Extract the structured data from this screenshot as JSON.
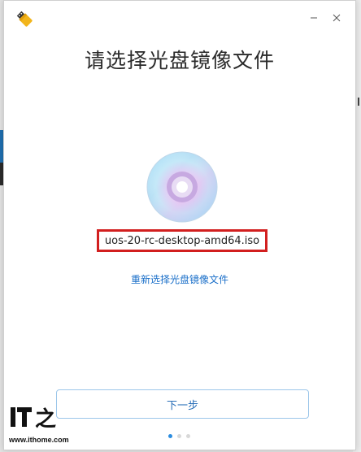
{
  "window": {
    "title": "请选择光盘镜像文件",
    "app_icon": "usb-drive-icon",
    "minimize_icon": "minimize-icon",
    "close_icon": "close-icon"
  },
  "selection": {
    "disc_icon": "optical-disc-icon",
    "file_name": "uos-20-rc-desktop-amd64.iso",
    "reselect_label": "重新选择光盘镜像文件"
  },
  "footer": {
    "next_label": "下一步",
    "page_dots": 3,
    "active_page": 1
  },
  "watermark": {
    "logo": "IT之家",
    "url": "www.ithome.com"
  },
  "colors": {
    "accent": "#2b8de0",
    "link": "#1a6fc9",
    "highlight_border": "#d21f1f",
    "button_border": "#9cc6ea"
  }
}
